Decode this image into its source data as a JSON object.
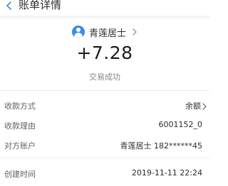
{
  "header": {
    "title": "账单详情"
  },
  "payee": {
    "name": "青莲居士"
  },
  "transaction": {
    "amount": "+7.28",
    "status": "交易成功"
  },
  "details": [
    {
      "label": "收款方式",
      "value": "余额"
    },
    {
      "label": "收款理由",
      "value": "6001152_0"
    },
    {
      "label": "对方账户",
      "value": "青莲居士 182******45"
    },
    {
      "label": "创建时间",
      "value": "2019-11-11 22:24"
    }
  ],
  "colors": {
    "avatar_bg": "#3c8ee8",
    "back_icon": "#3c8ee8"
  }
}
